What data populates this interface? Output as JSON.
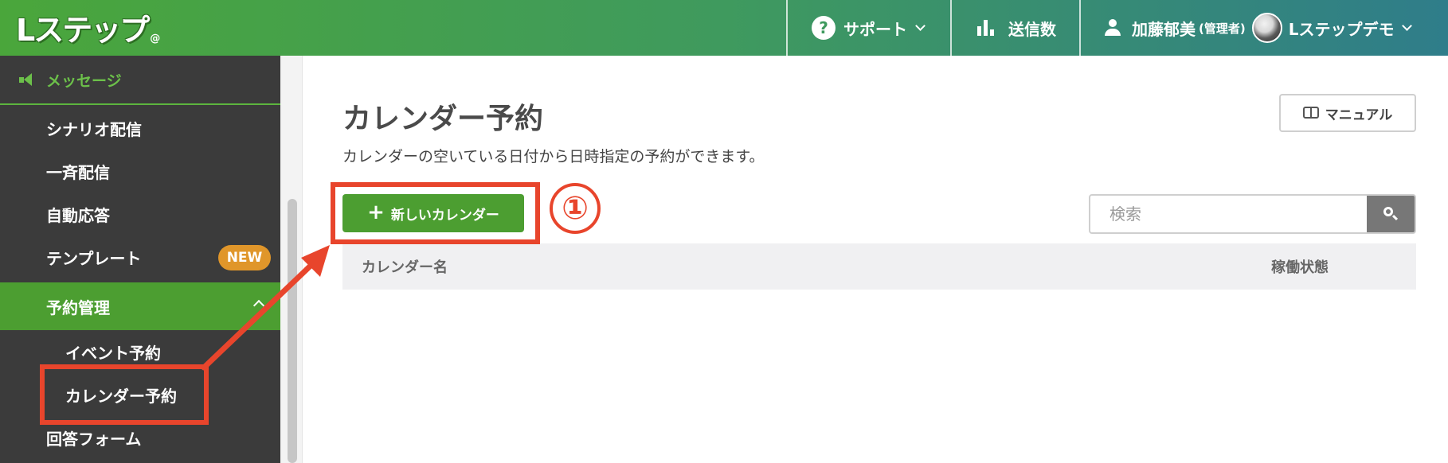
{
  "header": {
    "logo_text": "Lステップ",
    "logo_mark": "@",
    "support_label": "サポート",
    "support_icon": "?",
    "count_label": "送信数",
    "user_name": "加藤郁美",
    "user_role": "(管理者)",
    "account_name": "Lステップデモ"
  },
  "sidebar": {
    "section_label": "メッセージ",
    "items": [
      {
        "label": "シナリオ配信"
      },
      {
        "label": "一斉配信"
      },
      {
        "label": "自動応答"
      },
      {
        "label": "テンプレート",
        "badge": "NEW"
      },
      {
        "label": "予約管理"
      },
      {
        "label": "イベント予約"
      },
      {
        "label": "カレンダー予約"
      },
      {
        "label": "回答フォーム"
      }
    ]
  },
  "main": {
    "title": "カレンダー予約",
    "description": "カレンダーの空いている日付から日時指定の予約ができます。",
    "manual_label": "マニュアル",
    "new_calendar_label": "新しいカレンダー",
    "search_placeholder": "検索",
    "table": {
      "columns": [
        "カレンダー名",
        "稼働状態"
      ]
    }
  },
  "annotation": {
    "step_number": "①",
    "color": "#e8452c"
  },
  "colors": {
    "brand_green": "#4c9e31",
    "sidebar_bg": "#3b3b3b",
    "badge_orange": "#e0962a"
  }
}
